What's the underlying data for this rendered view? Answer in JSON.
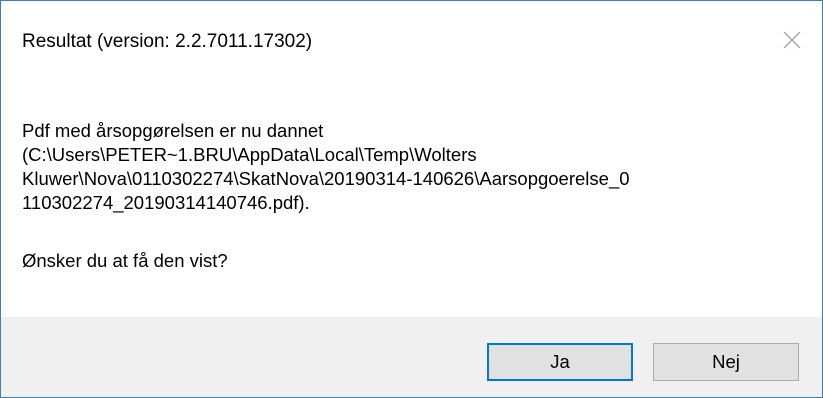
{
  "dialog": {
    "title": "Resultat (version: 2.2.7011.17302)",
    "close_icon": "close-icon",
    "message_lines": [
      "Pdf med årsopgørelsen er nu dannet",
      "(C:\\Users\\PETER~1.BRU\\AppData\\Local\\Temp\\Wolters",
      "Kluwer\\Nova\\0110302274\\SkatNova\\20190314-140626\\Aarsopgoerelse_0",
      "110302274_20190314140746.pdf)."
    ],
    "question": "Ønsker du at få den vist?",
    "buttons": {
      "yes_label": "Ja",
      "no_label": "Nej"
    }
  },
  "colors": {
    "border": "#3c7fb1",
    "footer_bg": "#f0f0f0",
    "button_bg": "#e1e1e1",
    "button_border": "#adadad",
    "default_button_border": "#0078d7"
  }
}
